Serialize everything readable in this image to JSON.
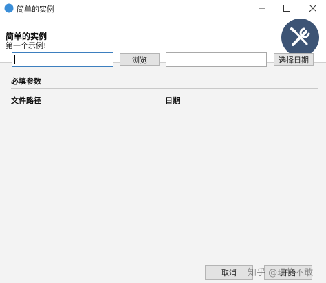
{
  "window": {
    "title": "简单的实例",
    "minimize_icon": "minimize-icon",
    "maximize_icon": "maximize-icon",
    "close_icon": "close-icon",
    "app_icon": "app-logo-icon"
  },
  "header": {
    "title": "简单的实例",
    "subtitle": "第一个示例!",
    "badge_icon": "tools-icon",
    "badge_color": "#3d5475"
  },
  "form": {
    "section_title": "必填参数",
    "path_label": "文件路径",
    "path_value": "",
    "browse_button": "浏览",
    "date_label": "日期",
    "date_value": "",
    "pick_date_button": "选择日期"
  },
  "footer": {
    "cancel_button": "取消",
    "run_button": "开始"
  },
  "watermark": "知乎 @玩物不敢"
}
